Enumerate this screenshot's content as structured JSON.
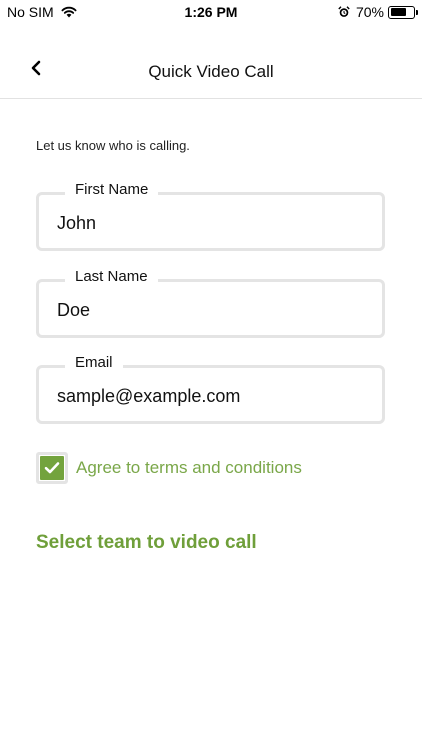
{
  "status_bar": {
    "carrier": "No SIM",
    "time": "1:26 PM",
    "battery_percent": "70%",
    "battery_level": 0.7,
    "icons": [
      "wifi-icon",
      "alarm-icon",
      "battery-icon"
    ]
  },
  "nav": {
    "title": "Quick Video Call",
    "back_icon": "chevron-left-icon"
  },
  "form": {
    "intro": "Let us know who is calling.",
    "first_name": {
      "label": "First Name",
      "value": "John"
    },
    "last_name": {
      "label": "Last Name",
      "value": "Doe"
    },
    "email": {
      "label": "Email",
      "value": "sample@example.com"
    },
    "terms": {
      "label": "Agree to terms and conditions",
      "checked": true
    }
  },
  "actions": {
    "select_team": "Select team to video call"
  },
  "colors": {
    "accent": "#73a33d",
    "accent_text": "#7aa749",
    "border": "#e4e4e4"
  }
}
